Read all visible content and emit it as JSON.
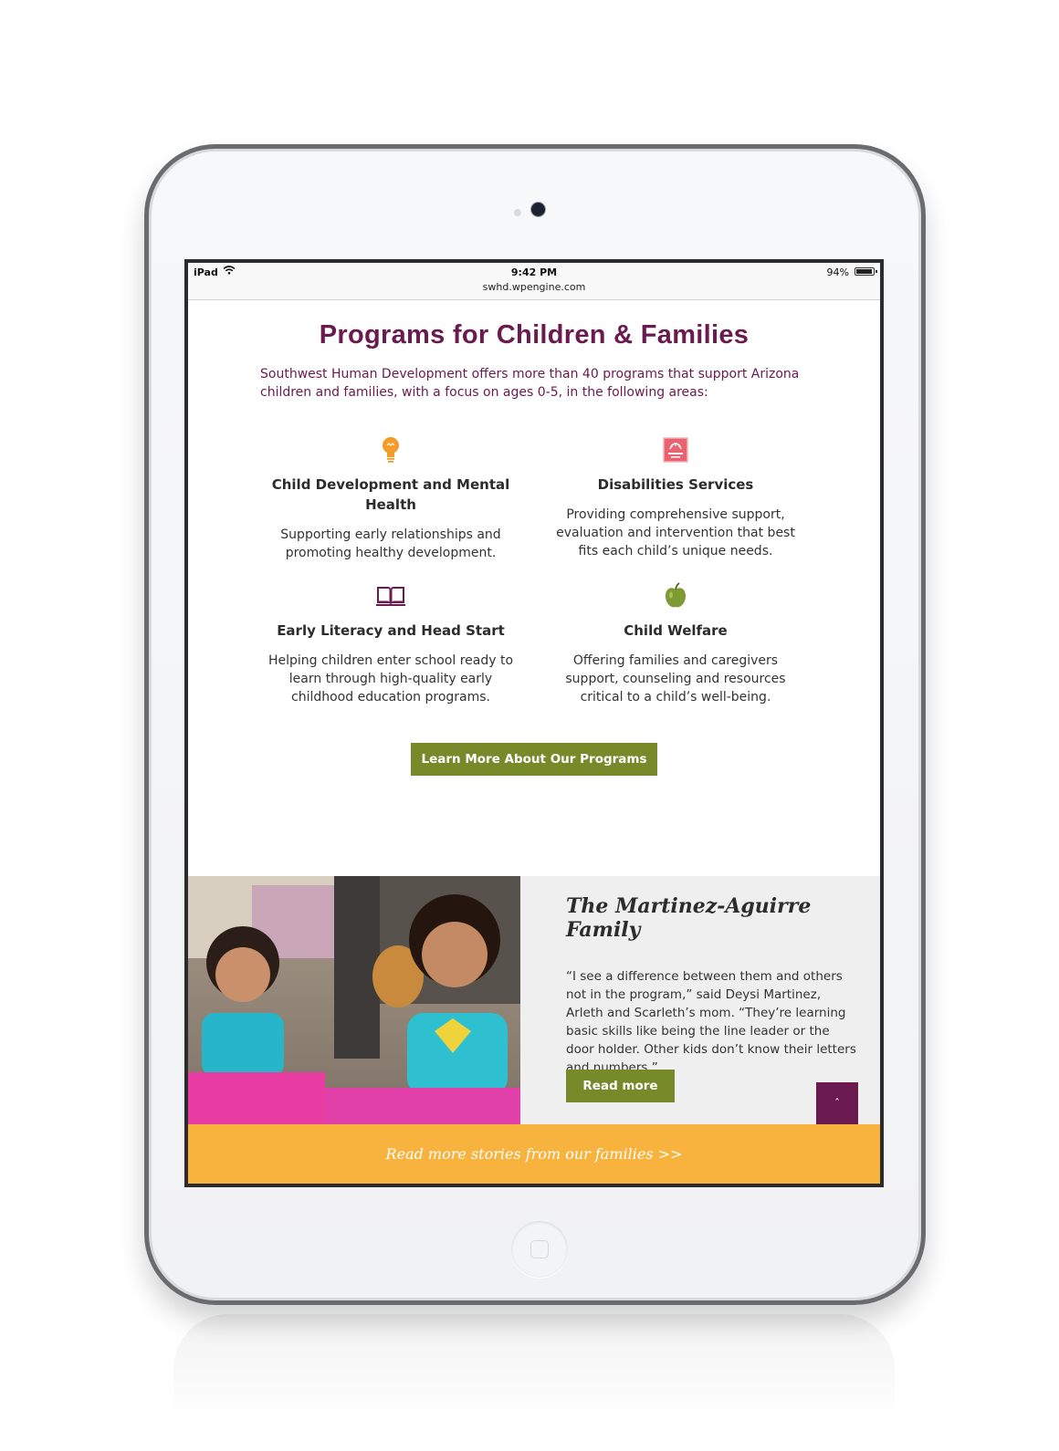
{
  "status_bar": {
    "device": "iPad",
    "time": "9:42 PM",
    "url": "swhd.wpengine.com",
    "battery": "94%"
  },
  "page": {
    "title": "Programs for Children & Families",
    "intro": "Southwest Human Development offers more than 40 programs that support Arizona children and families, with a focus on ages 0-5, in the following areas:"
  },
  "programs": [
    {
      "icon": "lightbulb-icon",
      "title": "Child Development and Mental Health",
      "description": "Supporting early relationships and promoting healthy development."
    },
    {
      "icon": "hand-logo-icon",
      "title": "Disabilities Services",
      "description": "Providing comprehensive support, evaluation and intervention that best fits each child’s unique needs."
    },
    {
      "icon": "book-icon",
      "title": "Early Literacy and Head Start",
      "description": "Helping children enter school ready to learn through high-quality early childhood education programs."
    },
    {
      "icon": "apple-icon",
      "title": "Child Welfare",
      "description": "Offering families and caregivers support, counseling and resources critical to a child’s well-being."
    }
  ],
  "cta": {
    "label": "Learn More About Our Programs"
  },
  "story": {
    "title": "The Martinez-Aguirre Family",
    "quote": "“I see a difference between them and others not in the program,” said Deysi Martinez, Arleth and Scarleth’s mom. “They’re learning basic skills like being the line leader or the door holder. Other kids don’t know their letters and numbers.”",
    "read_more": "Read more",
    "to_top": "ˆ"
  },
  "stories_banner": {
    "label": "Read more stories from our families >>"
  },
  "colors": {
    "brand_purple": "#6a1a4f",
    "brand_green": "#768a2a",
    "brand_orange": "#f8b33f",
    "icon_orange": "#f39c2a",
    "icon_pink": "#e8636f"
  }
}
